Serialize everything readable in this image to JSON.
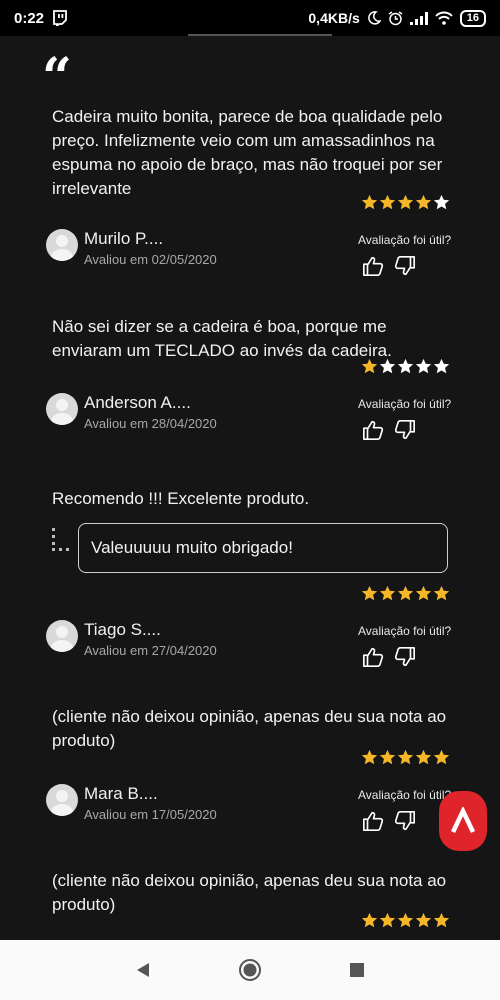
{
  "status_bar": {
    "time": "0:22",
    "speed": "0,4KB/s",
    "battery": "16"
  },
  "colors": {
    "background": "#151515",
    "star_filled": "#f5b72a",
    "star_empty": "#ffffff",
    "fab": "#e0242c"
  },
  "icons": {
    "quote": "quote-mark-icon",
    "thumb_up": "thumbs-up-icon",
    "thumb_down": "thumbs-down-icon",
    "avatar": "default-avatar-icon",
    "fab": "brand-logo-icon"
  },
  "quote_glyph": "“",
  "helpful_label": "Avaliação foi útil?",
  "reviews": [
    {
      "text": "Cadeira muito bonita, parece de boa qualidade pelo preço. Infelizmente veio com um amassadinhos na espuma no apoio de braço, mas não troquei por ser irrelevante",
      "rating": 4,
      "name": "Murilo P....",
      "date": "Avaliou em 02/05/2020"
    },
    {
      "text": "Não sei dizer se a cadeira é boa, porque me enviaram um TECLADO ao invés da cadeira.",
      "rating": 1,
      "name": "Anderson A....",
      "date": "Avaliou em 28/04/2020"
    },
    {
      "text": "Recomendo !!! Excelente produto.",
      "reply": "Valeuuuuu muito obrigado!",
      "rating": 5,
      "name": "Tiago S....",
      "date": "Avaliou em 27/04/2020"
    },
    {
      "text": "(cliente não deixou opinião, apenas deu sua nota ao produto)",
      "rating": 5,
      "name": "Mara B....",
      "date": "Avaliou em 17/05/2020"
    },
    {
      "text": "(cliente não deixou opinião, apenas deu sua nota ao produto)",
      "rating": 5
    }
  ]
}
